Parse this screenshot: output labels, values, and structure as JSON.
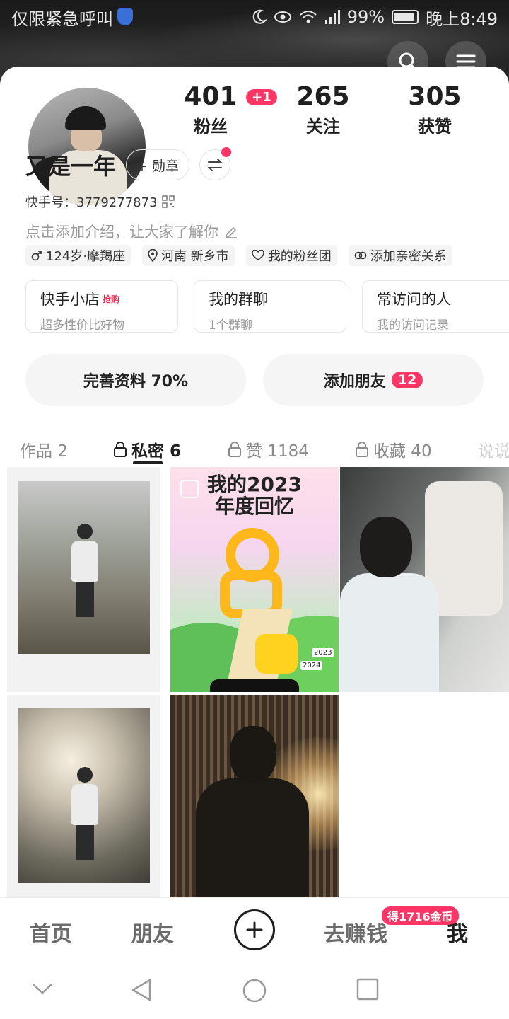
{
  "status_bar": {
    "carrier": "仅限紧急呼叫",
    "battery": "99%",
    "time": "晚上8:49"
  },
  "stats": [
    {
      "value": "401",
      "label": "粉丝",
      "badge": "+1"
    },
    {
      "value": "265",
      "label": "关注"
    },
    {
      "value": "305",
      "label": "获赞"
    }
  ],
  "profile": {
    "name": "又是一年",
    "medal_button": "+ 勋章",
    "kuaishou_id": "快手号：3779277873",
    "bio_placeholder": "点击添加介绍，让大家了解你",
    "tags": [
      "124岁·摩羯座",
      "河南 新乡市",
      "我的粉丝团",
      "添加亲密关系"
    ]
  },
  "quick_cards": [
    {
      "title": "快手小店",
      "hot": "抢购",
      "subtitle": "超多性价比好物"
    },
    {
      "title": "我的群聊",
      "subtitle": "1个群聊"
    },
    {
      "title": "常访问的人",
      "subtitle": "我的访问记录"
    }
  ],
  "actions": {
    "complete_profile": "完善资料 70%",
    "add_friends": "添加朋友",
    "add_friends_count": "12"
  },
  "tabs": [
    {
      "label": "作品 2",
      "locked": false
    },
    {
      "label": "私密 6",
      "locked": true,
      "active": true
    },
    {
      "label": "赞 1184",
      "locked": true
    },
    {
      "label": "收藏 40",
      "locked": true
    },
    {
      "label": "说说",
      "locked": false
    }
  ],
  "grid": {
    "promo_title_line1": "我的2023",
    "promo_title_line2": "年度回忆",
    "promo_sign1": "2023",
    "promo_sign2": "2024"
  },
  "bottom_nav": {
    "home": "首页",
    "friends": "朋友",
    "earn": "去赚钱",
    "earn_badge": "得1716金币",
    "me": "我"
  },
  "colors": {
    "accent": "#fe3666",
    "text": "#1f1f1f",
    "muted": "#9a9a9a"
  }
}
